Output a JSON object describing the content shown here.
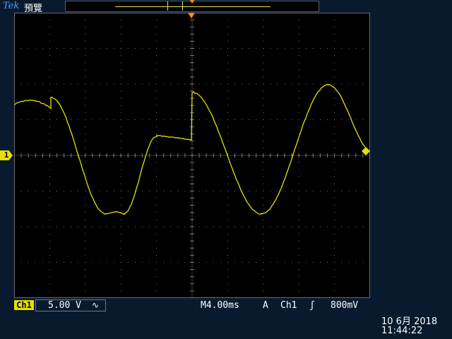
{
  "header": {
    "brand": "Tek",
    "mode": "預覽"
  },
  "channel": {
    "marker": "1",
    "name": "Ch1",
    "volts_div": "5.00 V",
    "coupling": "∿",
    "color": "#e5e000"
  },
  "timebase": {
    "value": "M4.00ms"
  },
  "trigger": {
    "mode": "A",
    "source": "Ch1",
    "slope": "ʃ",
    "level": "800mV",
    "color": "#ff8c1a"
  },
  "datetime": {
    "date": "10 6月  2018",
    "time": "11:44:22"
  }
}
